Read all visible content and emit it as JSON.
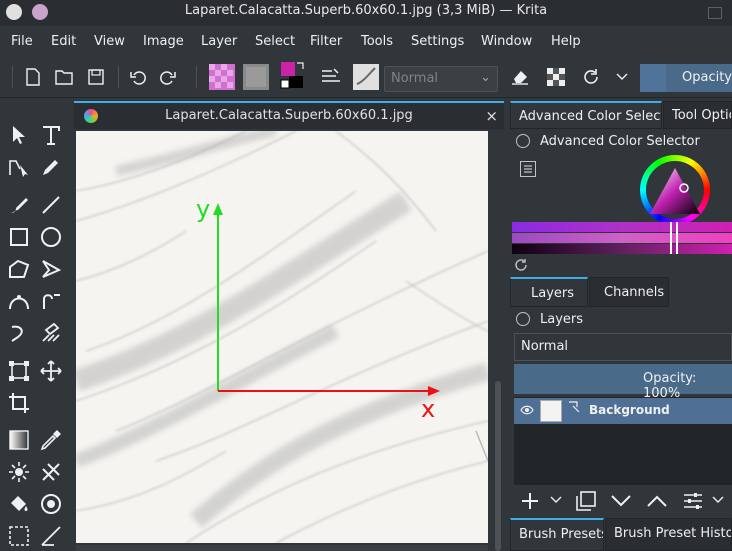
{
  "window": {
    "title": "Laparet.Calacatta.Superb.60x60.1.jpg (3,3 MiB) — Krita"
  },
  "menu": [
    "File",
    "Edit",
    "View",
    "Image",
    "Layer",
    "Select",
    "Filter",
    "Tools",
    "Settings",
    "Window",
    "Help"
  ],
  "toolbar": {
    "blend_mode": "Normal",
    "opacity_label": "Opacity:"
  },
  "document": {
    "tab_title": "Laparet.Calacatta.Superb.60x60.1.jpg",
    "close_glyph": "×"
  },
  "canvas": {
    "axis_y_label": "y",
    "axis_x_label": "x",
    "colors": {
      "y_axis": "#22dd22",
      "x_axis": "#ee1111"
    }
  },
  "dock_tabs": {
    "tab1": "Advanced Color Selector",
    "tab2": "Tool Options"
  },
  "color_selector": {
    "header": "Advanced Color Selector"
  },
  "layers_tabs": {
    "tab1": "Layers",
    "tab2": "Channels"
  },
  "layers": {
    "header": "Layers",
    "blend_mode": "Normal",
    "opacity": "Opacity:  100%",
    "items": [
      {
        "name": "Background",
        "visible": true,
        "selected": true
      }
    ]
  },
  "brush_tabs": {
    "tab1": "Brush Presets",
    "tab2": "Brush Preset History"
  },
  "theme": {
    "accent": "#3daee9",
    "selection": "#4f6f95",
    "bg": "#31363b"
  }
}
